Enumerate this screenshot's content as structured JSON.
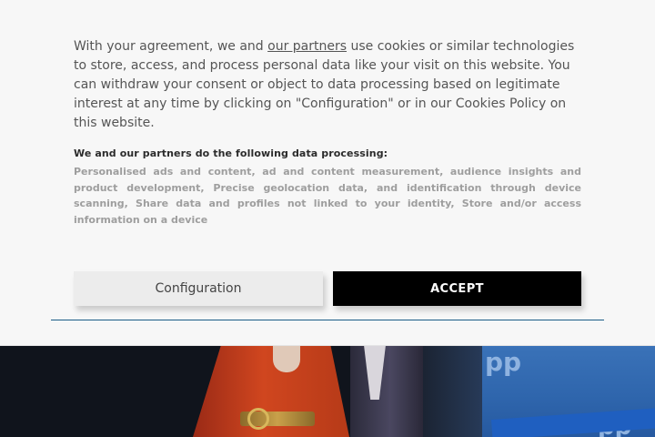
{
  "banner": {
    "intro_before_link": "With your agreement, we and ",
    "partners_link": "our partners",
    "intro_after_link": " use cookies or similar technologies to store, access, and process personal data like your visit on this website. You can withdraw your consent or object to data processing based on legitimate interest at any time by clicking on \"Configuration\" or in our Cookies Policy on this website.",
    "processing_title": "We and our partners do the following data processing:",
    "processing_list": "Personalised ads and content, ad and content measurement, audience insights and product development, Precise geolocation data, and identification through device scanning, Share data and profiles not linked to your identity, Store and/or access information on a device",
    "configuration_label": "Configuration",
    "accept_label": "ACCEPT",
    "divider_color": "#1b5d86"
  },
  "background_image": {
    "logo_text": "pp"
  }
}
